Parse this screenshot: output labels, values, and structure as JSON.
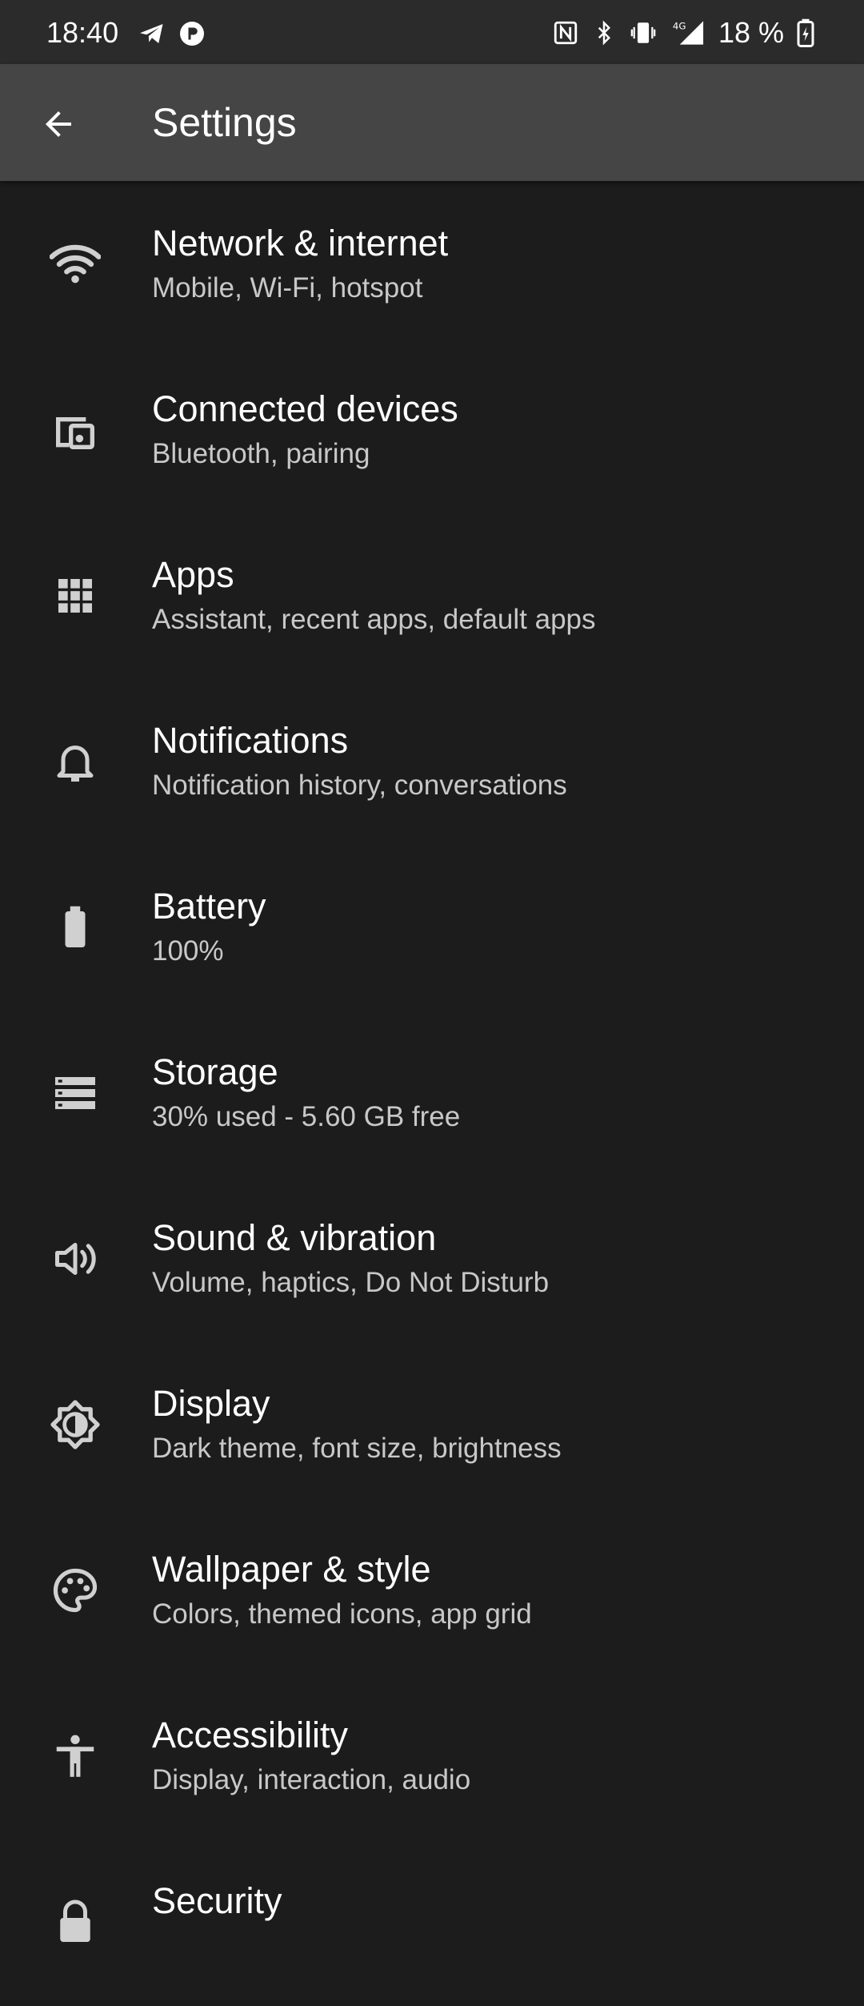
{
  "status_bar": {
    "time": "18:40",
    "left_icons": [
      "telegram-icon",
      "app-notification-icon"
    ],
    "right_icons": [
      "nfc-icon",
      "bluetooth-icon",
      "vibrate-icon",
      "signal-4g-icon",
      "battery-charging-icon"
    ],
    "battery_text": "18 %"
  },
  "app_bar": {
    "title": "Settings",
    "back_icon": "arrow-back-icon"
  },
  "items": [
    {
      "title": "Network & internet",
      "subtitle": "Mobile, Wi‑Fi, hotspot",
      "icon": "wifi-icon"
    },
    {
      "title": "Connected devices",
      "subtitle": "Bluetooth, pairing",
      "icon": "devices-icon"
    },
    {
      "title": "Apps",
      "subtitle": "Assistant, recent apps, default apps",
      "icon": "apps-grid-icon"
    },
    {
      "title": "Notifications",
      "subtitle": "Notification history, conversations",
      "icon": "bell-icon"
    },
    {
      "title": "Battery",
      "subtitle": "100%",
      "icon": "battery-icon"
    },
    {
      "title": "Storage",
      "subtitle": "30% used - 5.60 GB free",
      "icon": "storage-icon"
    },
    {
      "title": "Sound & vibration",
      "subtitle": "Volume, haptics, Do Not Disturb",
      "icon": "volume-icon"
    },
    {
      "title": "Display",
      "subtitle": "Dark theme, font size, brightness",
      "icon": "brightness-icon"
    },
    {
      "title": "Wallpaper & style",
      "subtitle": "Colors, themed icons, app grid",
      "icon": "palette-icon"
    },
    {
      "title": "Accessibility",
      "subtitle": "Display, interaction, audio",
      "icon": "accessibility-icon"
    },
    {
      "title": "Security",
      "subtitle": "",
      "icon": "lock-icon"
    }
  ],
  "colors": {
    "background": "#1c1c1c",
    "app_bar": "#454545",
    "status_bar": "#2b2b2b",
    "title_text": "#ffffff",
    "subtitle_text": "#c8c8c8",
    "icon": "#d0d0d0"
  }
}
